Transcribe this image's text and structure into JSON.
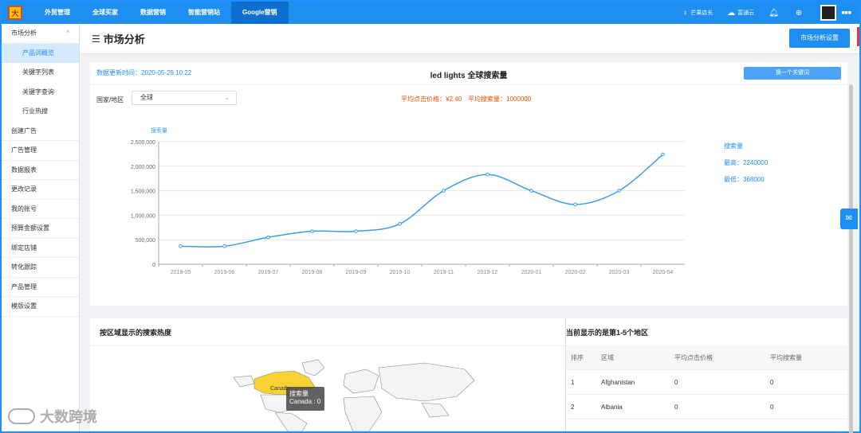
{
  "app": {
    "logo_text": "大",
    "nav": [
      "外贸管理",
      "全球买家",
      "数据营销",
      "智能营销站",
      "Google营销"
    ],
    "nav_active_index": 4,
    "top_right": [
      "芒果店长",
      "富通云"
    ],
    "username": "■■■"
  },
  "sidebar": {
    "items": [
      {
        "label": "市场分析",
        "level": 1,
        "caret": "^"
      },
      {
        "label": "产品词概览",
        "level": 2,
        "active": true
      },
      {
        "label": "关键字列表",
        "level": 2
      },
      {
        "label": "关键字查询",
        "level": 2
      },
      {
        "label": "行业热搜",
        "level": 2
      },
      {
        "label": "创建广告",
        "level": 1
      },
      {
        "label": "广告管理",
        "level": 1
      },
      {
        "label": "数据报表",
        "level": 1
      },
      {
        "label": "更改记录",
        "level": 1
      },
      {
        "label": "我的账号",
        "level": 1
      },
      {
        "label": "预算金额设置",
        "level": 1
      },
      {
        "label": "绑定店铺",
        "level": 1
      },
      {
        "label": "转化跟踪",
        "level": 1
      },
      {
        "label": "产品管理",
        "level": 1
      },
      {
        "label": "模版设置",
        "level": 1
      }
    ]
  },
  "header": {
    "title": "市场分析",
    "settings_button": "市场分析设置"
  },
  "overview": {
    "updated": "数据更新时间：2020-05-29 10:22",
    "title": "led lights 全球搜索量",
    "swap_button": "换一个关键词",
    "region_label": "国家/地区",
    "region_value": "全球",
    "avg_info": "平均点击价格：¥2.40　平均搜索量：1000000",
    "legend_name": "搜索量",
    "max_text": "最高：2240000",
    "min_text": "最低：368000"
  },
  "chart_data": {
    "type": "line",
    "ylabel": "搜索量",
    "categories": [
      "2019-05",
      "2019-06",
      "2019-07",
      "2019-08",
      "2019-09",
      "2019-10",
      "2019-11",
      "2019-12",
      "2020-01",
      "2020-02",
      "2020-03",
      "2020-04"
    ],
    "series": [
      {
        "name": "搜索量",
        "values": [
          368000,
          368000,
          550000,
          673000,
          673000,
          823000,
          1500000,
          1830000,
          1500000,
          1220000,
          1500000,
          2240000
        ]
      }
    ],
    "ylim": [
      0,
      2500000
    ],
    "yticks": [
      "0",
      "500,000",
      "1,000,000",
      "1,500,000",
      "2,000,000",
      "2,500,000"
    ],
    "color": "#3a9ee4",
    "grid": true
  },
  "region_section": {
    "title": "按区域显示的搜索热度",
    "tooltip_title": "搜索量",
    "tooltip_value": "Canada : 0",
    "map_label": "Canada"
  },
  "table_section": {
    "title": "当前显示的是第1-5个地区",
    "headers": [
      "排序",
      "区域",
      "平均点击价格",
      "平均搜索量"
    ],
    "rows": [
      [
        "1",
        "Afghanistan",
        "0",
        "0"
      ],
      [
        "2",
        "Albania",
        "0",
        "0"
      ]
    ]
  },
  "watermark": "大数跨境"
}
